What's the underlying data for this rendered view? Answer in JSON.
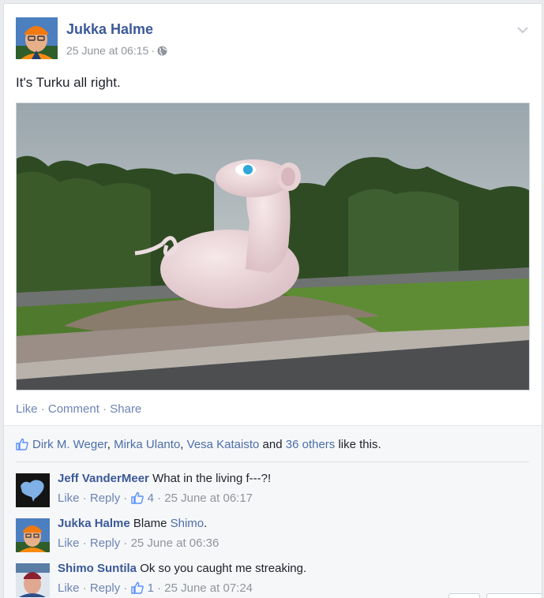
{
  "post": {
    "author": "Jukka Halme",
    "timestamp": "25 June at 06:15",
    "text": "It's Turku all right.",
    "privacy_icon": "globe-icon"
  },
  "actions": {
    "like": "Like",
    "comment": "Comment",
    "share": "Share",
    "separator": "·"
  },
  "likes": {
    "names": [
      "Dirk M. Weger",
      "Mirka Ulanto",
      "Vesa Kataisto"
    ],
    "comma": ",",
    "and": "and",
    "others": "36 others",
    "suffix": "like this."
  },
  "comments": [
    {
      "author": "Jeff VanderMeer",
      "text": "What in the living f---?!",
      "like": "Like",
      "reply": "Reply",
      "likes_count": "4",
      "timestamp": "25 June at 06:17"
    },
    {
      "author": "Jukka Halme",
      "text_before": "Blame",
      "mention": "Shimo",
      "text_after": ".",
      "like": "Like",
      "reply": "Reply",
      "timestamp": "25 June at 06:36"
    },
    {
      "author": "Shimo Suntila",
      "text": "Ok so you caught me streaking.",
      "like": "Like",
      "reply": "Reply",
      "likes_count": "1",
      "timestamp": "25 June at 07:24"
    }
  ],
  "colors": {
    "link_blue": "#3b5998",
    "meta_gray": "#90949c",
    "feedback_bg": "#f6f7f9"
  }
}
